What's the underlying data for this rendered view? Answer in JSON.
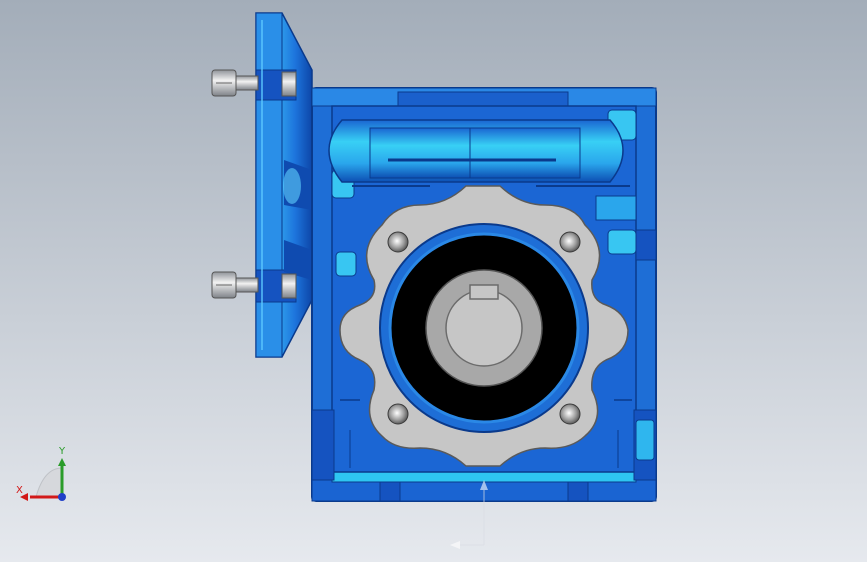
{
  "viewport": {
    "background_top": "#a3adb9",
    "background_bottom": "#e6e9ee"
  },
  "model": {
    "housing_color": "#1e6ed6",
    "housing_light": "#2fc4f0",
    "housing_dark": "#0b3fa0",
    "flange_color": "#c6c6c6",
    "bore_color": "#000000",
    "bolt_color": "#b9bcc0"
  },
  "triad": {
    "x_label": "X",
    "y_label": "Y",
    "x_color": "#d21919",
    "y_color": "#2a9c2a",
    "z_color": "#2040c8"
  }
}
